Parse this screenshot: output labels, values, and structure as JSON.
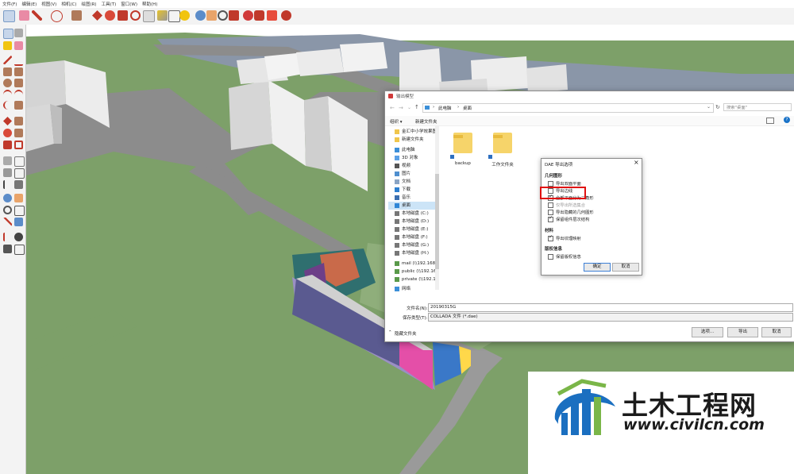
{
  "menu": [
    "文件(F)",
    "编辑(E)",
    "视图(V)",
    "相机(C)",
    "绘图(R)",
    "工具(T)",
    "窗口(W)",
    "帮助(H)"
  ],
  "save_dialog": {
    "title": "输出模型",
    "breadcrumb": [
      "此电脑",
      "桌面"
    ],
    "search_placeholder": "搜索\"桌面\"",
    "organize_label": "组织 ▾",
    "new_folder_label": "新建文件夹",
    "nav_items": [
      {
        "label": "金汇中小学效果图",
        "icon": "folder-icon"
      },
      {
        "label": "新建文件夹",
        "icon": "folder-icon"
      },
      {
        "label": "此电脑",
        "icon": "computer-icon"
      },
      {
        "label": "3D 对象",
        "icon": "cube-icon"
      },
      {
        "label": "视频",
        "icon": "video-icon"
      },
      {
        "label": "图片",
        "icon": "picture-icon"
      },
      {
        "label": "文档",
        "icon": "document-icon"
      },
      {
        "label": "下载",
        "icon": "download-icon"
      },
      {
        "label": "音乐",
        "icon": "music-icon"
      },
      {
        "label": "桌面",
        "icon": "desktop-icon"
      },
      {
        "label": "本地磁盘 (C:)",
        "icon": "drive-icon"
      },
      {
        "label": "本地磁盘 (D:)",
        "icon": "drive-icon"
      },
      {
        "label": "本地磁盘 (E:)",
        "icon": "drive-icon"
      },
      {
        "label": "本地磁盘 (F:)",
        "icon": "drive-icon"
      },
      {
        "label": "本地磁盘 (G:)",
        "icon": "drive-icon"
      },
      {
        "label": "本地磁盘 (H:)",
        "icon": "drive-icon"
      },
      {
        "label": "mail (\\\\192.168",
        "icon": "network-drive-icon"
      },
      {
        "label": "public (\\\\192.16",
        "icon": "network-drive-icon"
      },
      {
        "label": "private (\\\\192.1",
        "icon": "network-drive-icon"
      },
      {
        "label": "网络",
        "icon": "network-icon"
      }
    ],
    "files": [
      {
        "name": "backup",
        "icon": "folder-shortcut-icon"
      },
      {
        "name": "工作文件夹",
        "icon": "folder-shortcut-icon"
      }
    ],
    "filename_label": "文件名(N):",
    "filename_value": "20190315G",
    "filetype_label": "保存类型(T):",
    "filetype_value": "COLLADA 文件 (*.dae)",
    "hide_folders_label": "隐藏文件夹",
    "options_button": "选项...",
    "export_button": "导出",
    "cancel_button": "取消"
  },
  "dae_dialog": {
    "title": "DAE 导出选项",
    "section_geometry": "几何图形",
    "geometry_options": [
      {
        "label": "导出双面平面",
        "checked": false,
        "disabled": false
      },
      {
        "label": "导出边线",
        "checked": false,
        "disabled": false
      },
      {
        "label": "全部平面分为三角形",
        "checked": true,
        "disabled": false
      },
      {
        "label": "仅导出所选集合",
        "checked": false,
        "disabled": true
      },
      {
        "label": "导出隐藏的几何图形",
        "checked": false,
        "disabled": false
      },
      {
        "label": "保留组件层次结构",
        "checked": true,
        "disabled": false
      }
    ],
    "section_material": "材料",
    "material_options": [
      {
        "label": "导出纹理映射",
        "checked": true,
        "disabled": false
      }
    ],
    "section_credits": "版权信息",
    "credit_options": [
      {
        "label": "保留版权信息",
        "checked": false,
        "disabled": false
      }
    ],
    "ok_button": "确定",
    "cancel_button": "取消"
  },
  "watermark": {
    "brand": "土木工程网",
    "url": "www.civilcn.com"
  },
  "colors": {
    "grass": "#7da069",
    "road": "#8c8c8c",
    "sky": "#ffffff",
    "highlight": "#e01010",
    "watermark_blue": "#1b6fc0"
  }
}
